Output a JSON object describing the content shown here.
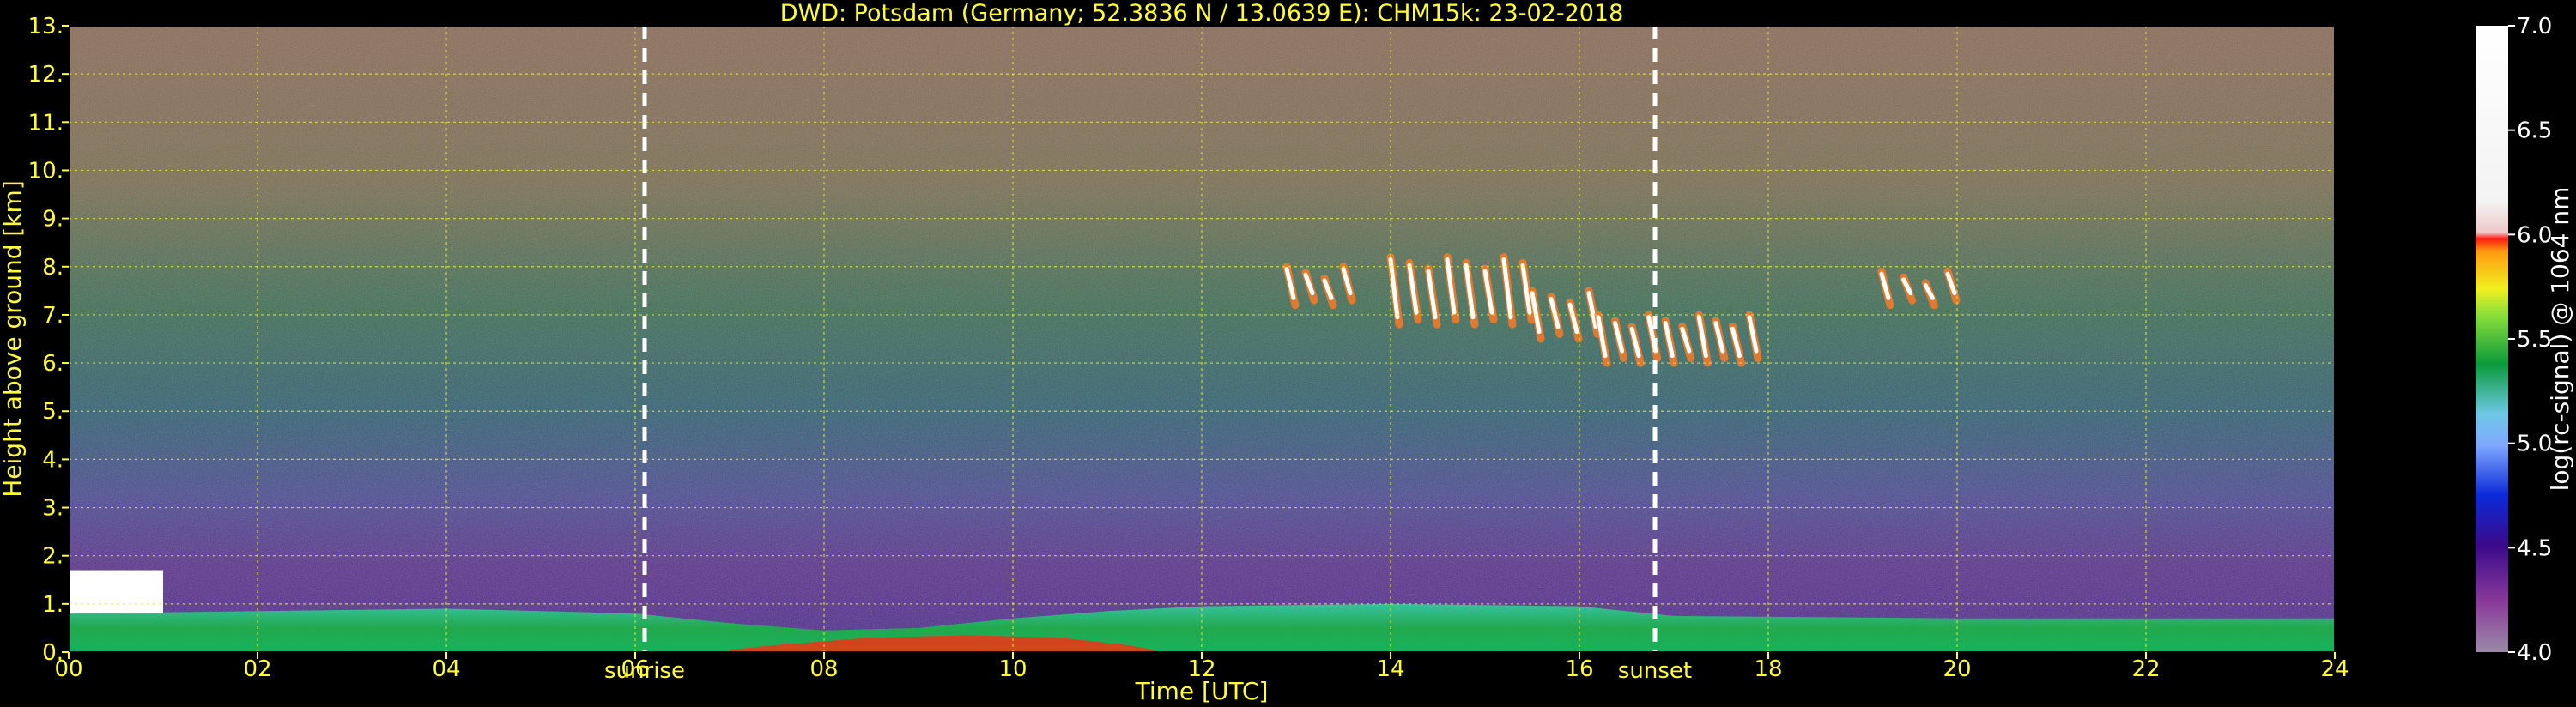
{
  "chart_data": {
    "type": "heatmap",
    "title": "DWD: Potsdam (Germany; 52.3836 N / 13.0639 E):    CHM15k: 23-02-2018",
    "xlabel": "Time [UTC]",
    "ylabel": "Height above ground [km]",
    "xlim": [
      0,
      24
    ],
    "ylim": [
      0,
      13
    ],
    "x_ticks": [
      "00",
      "02",
      "04",
      "06",
      "08",
      "10",
      "12",
      "14",
      "16",
      "18",
      "20",
      "22",
      "24"
    ],
    "x_tick_values": [
      0,
      2,
      4,
      6,
      8,
      10,
      12,
      14,
      16,
      18,
      20,
      22,
      24
    ],
    "y_ticks": [
      "0.",
      "1.",
      "2.",
      "3.",
      "4.",
      "5.",
      "6.",
      "7.",
      "8.",
      "9.",
      "10.",
      "11.",
      "12.",
      "13."
    ],
    "y_tick_values": [
      0,
      1,
      2,
      3,
      4,
      5,
      6,
      7,
      8,
      9,
      10,
      11,
      12,
      13
    ],
    "grid": true,
    "colorbar": {
      "label": "log(rc-signal) @ 1064 nm",
      "range": [
        4.0,
        7.0
      ],
      "ticks": [
        "4.0",
        "4.5",
        "5.0",
        "5.5",
        "6.0",
        "6.5",
        "7.0"
      ],
      "tick_values": [
        4.0,
        4.5,
        5.0,
        5.5,
        6.0,
        6.5,
        7.0
      ]
    },
    "annotations": [
      {
        "text": "sunrise",
        "time": 6.1
      },
      {
        "text": "sunset",
        "time": 16.8
      }
    ],
    "features": {
      "boundary_layer_top_km": [
        [
          0,
          0.8
        ],
        [
          2,
          0.85
        ],
        [
          4,
          0.9
        ],
        [
          6,
          0.8
        ],
        [
          7,
          0.6
        ],
        [
          8,
          0.45
        ],
        [
          9,
          0.5
        ],
        [
          10,
          0.7
        ],
        [
          11,
          0.85
        ],
        [
          12,
          0.95
        ],
        [
          14,
          1.0
        ],
        [
          16,
          0.95
        ],
        [
          17,
          0.75
        ],
        [
          20,
          0.7
        ],
        [
          24,
          0.7
        ]
      ],
      "low_cloud": {
        "time": [
          0,
          1.0
        ],
        "height_km": [
          0.8,
          1.7
        ]
      },
      "cirrus_segments": [
        {
          "time": [
            12.9,
            13.5
          ],
          "height_km": [
            7.2,
            8.0
          ]
        },
        {
          "time": [
            14.0,
            15.4
          ],
          "height_km": [
            6.8,
            8.2
          ]
        },
        {
          "time": [
            15.5,
            16.1
          ],
          "height_km": [
            6.5,
            7.5
          ]
        },
        {
          "time": [
            16.2,
            17.8
          ],
          "height_km": [
            6.0,
            7.0
          ]
        },
        {
          "time": [
            19.2,
            19.9
          ],
          "height_km": [
            7.2,
            7.9
          ]
        }
      ]
    }
  }
}
